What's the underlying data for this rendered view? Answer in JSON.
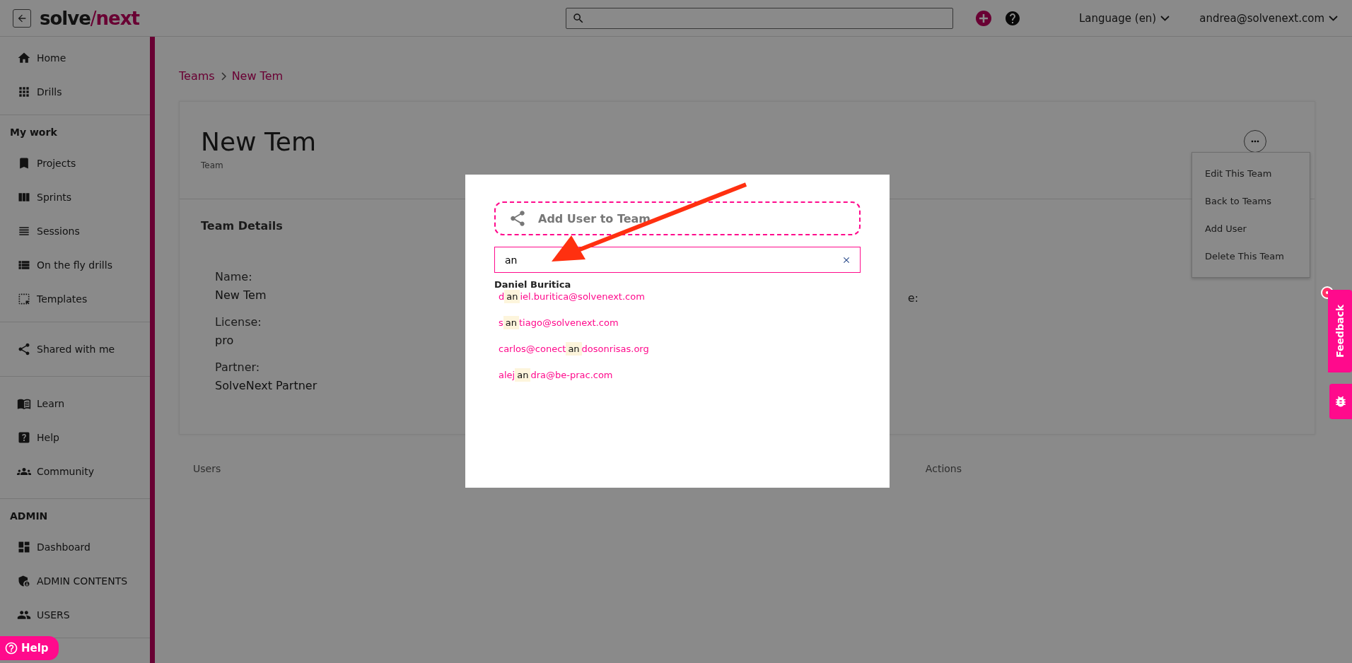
{
  "topbar": {
    "logo": {
      "first": "solve",
      "slash": "/",
      "second": "next"
    },
    "language": "Language (en)",
    "user": "andrea@solvenext.com"
  },
  "sidebar": {
    "sections": [
      {
        "items": [
          {
            "label": "Home"
          },
          {
            "label": "Drills"
          }
        ]
      },
      {
        "heading": "My work",
        "items": [
          {
            "label": "Projects"
          },
          {
            "label": "Sprints"
          },
          {
            "label": "Sessions"
          },
          {
            "label": "On the fly drills"
          },
          {
            "label": "Templates"
          }
        ]
      },
      {
        "items": [
          {
            "label": "Shared with me"
          }
        ]
      },
      {
        "items": [
          {
            "label": "Learn"
          },
          {
            "label": "Help"
          },
          {
            "label": "Community"
          }
        ]
      },
      {
        "heading": "ADMIN",
        "items": [
          {
            "label": "Dashboard"
          },
          {
            "label": "ADMIN CONTENTS"
          },
          {
            "label": "USERS"
          }
        ]
      }
    ]
  },
  "breadcrumb": [
    "Teams",
    "New Tem"
  ],
  "team": {
    "title": "New Tem",
    "subtitle": "Team",
    "details_title": "Team Details",
    "fields": [
      {
        "label": "Name:",
        "value": "New Tem"
      },
      {
        "label": "License:",
        "value": "pro"
      },
      {
        "label": "Partner:",
        "value": "SolveNext Partner"
      }
    ],
    "cut_label": "e:"
  },
  "actions_menu": [
    "Edit This Team",
    "Back to Teams",
    "Add User",
    "Delete This Team"
  ],
  "users_table": {
    "columns": [
      "Users",
      "Actions"
    ]
  },
  "modal": {
    "title": "Add User to Team",
    "search_value": "an",
    "result_name": "Daniel Buritica",
    "results": [
      {
        "before": "d",
        "match": "an",
        "after": "iel.buritica@solvenext.com"
      },
      {
        "before": "s",
        "match": "an",
        "after": "tiago@solvenext.com"
      },
      {
        "before": "carlos@conect",
        "match": "an",
        "after": "dosonrisas.org"
      },
      {
        "before": "alej",
        "match": "an",
        "after": "dra@be-prac.com"
      }
    ]
  },
  "feedback": "Feedback",
  "help_button": "Help"
}
